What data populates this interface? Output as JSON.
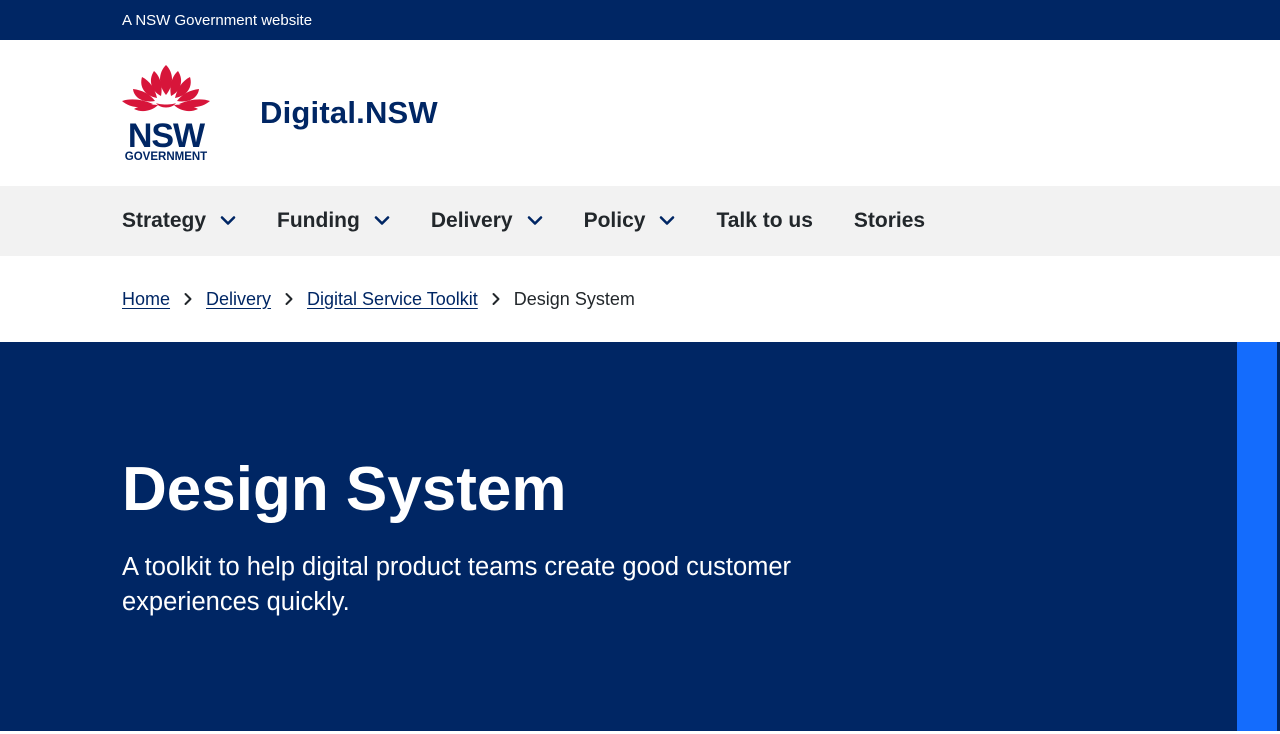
{
  "masthead": {
    "text": "A NSW Government website"
  },
  "header": {
    "logo": {
      "wordmark": "NSW",
      "subtext": "GOVERNMENT",
      "red": "#d7153a",
      "navy": "#002664"
    },
    "site_title": "Digital.NSW"
  },
  "nav": {
    "items": [
      {
        "label": "Strategy",
        "has_dropdown": true,
        "icon": "chevron-down-icon"
      },
      {
        "label": "Funding",
        "has_dropdown": true,
        "icon": "chevron-down-icon"
      },
      {
        "label": "Delivery",
        "has_dropdown": true,
        "icon": "chevron-down-icon"
      },
      {
        "label": "Policy",
        "has_dropdown": true,
        "icon": "chevron-down-icon"
      },
      {
        "label": "Talk to us",
        "has_dropdown": false
      },
      {
        "label": "Stories",
        "has_dropdown": false
      }
    ]
  },
  "breadcrumbs": {
    "items": [
      {
        "label": "Home"
      },
      {
        "label": "Delivery"
      },
      {
        "label": "Digital Service Toolkit"
      }
    ],
    "current": "Design System",
    "separator_icon": "chevron-right-icon"
  },
  "hero": {
    "title": "Design System",
    "intro": "A toolkit to help digital product teams create good customer experiences quickly."
  },
  "colors": {
    "primary_navy": "#002664",
    "accent_blue": "#146cfd",
    "nav_background": "#f2f2f2",
    "text_dark": "#22272b"
  }
}
